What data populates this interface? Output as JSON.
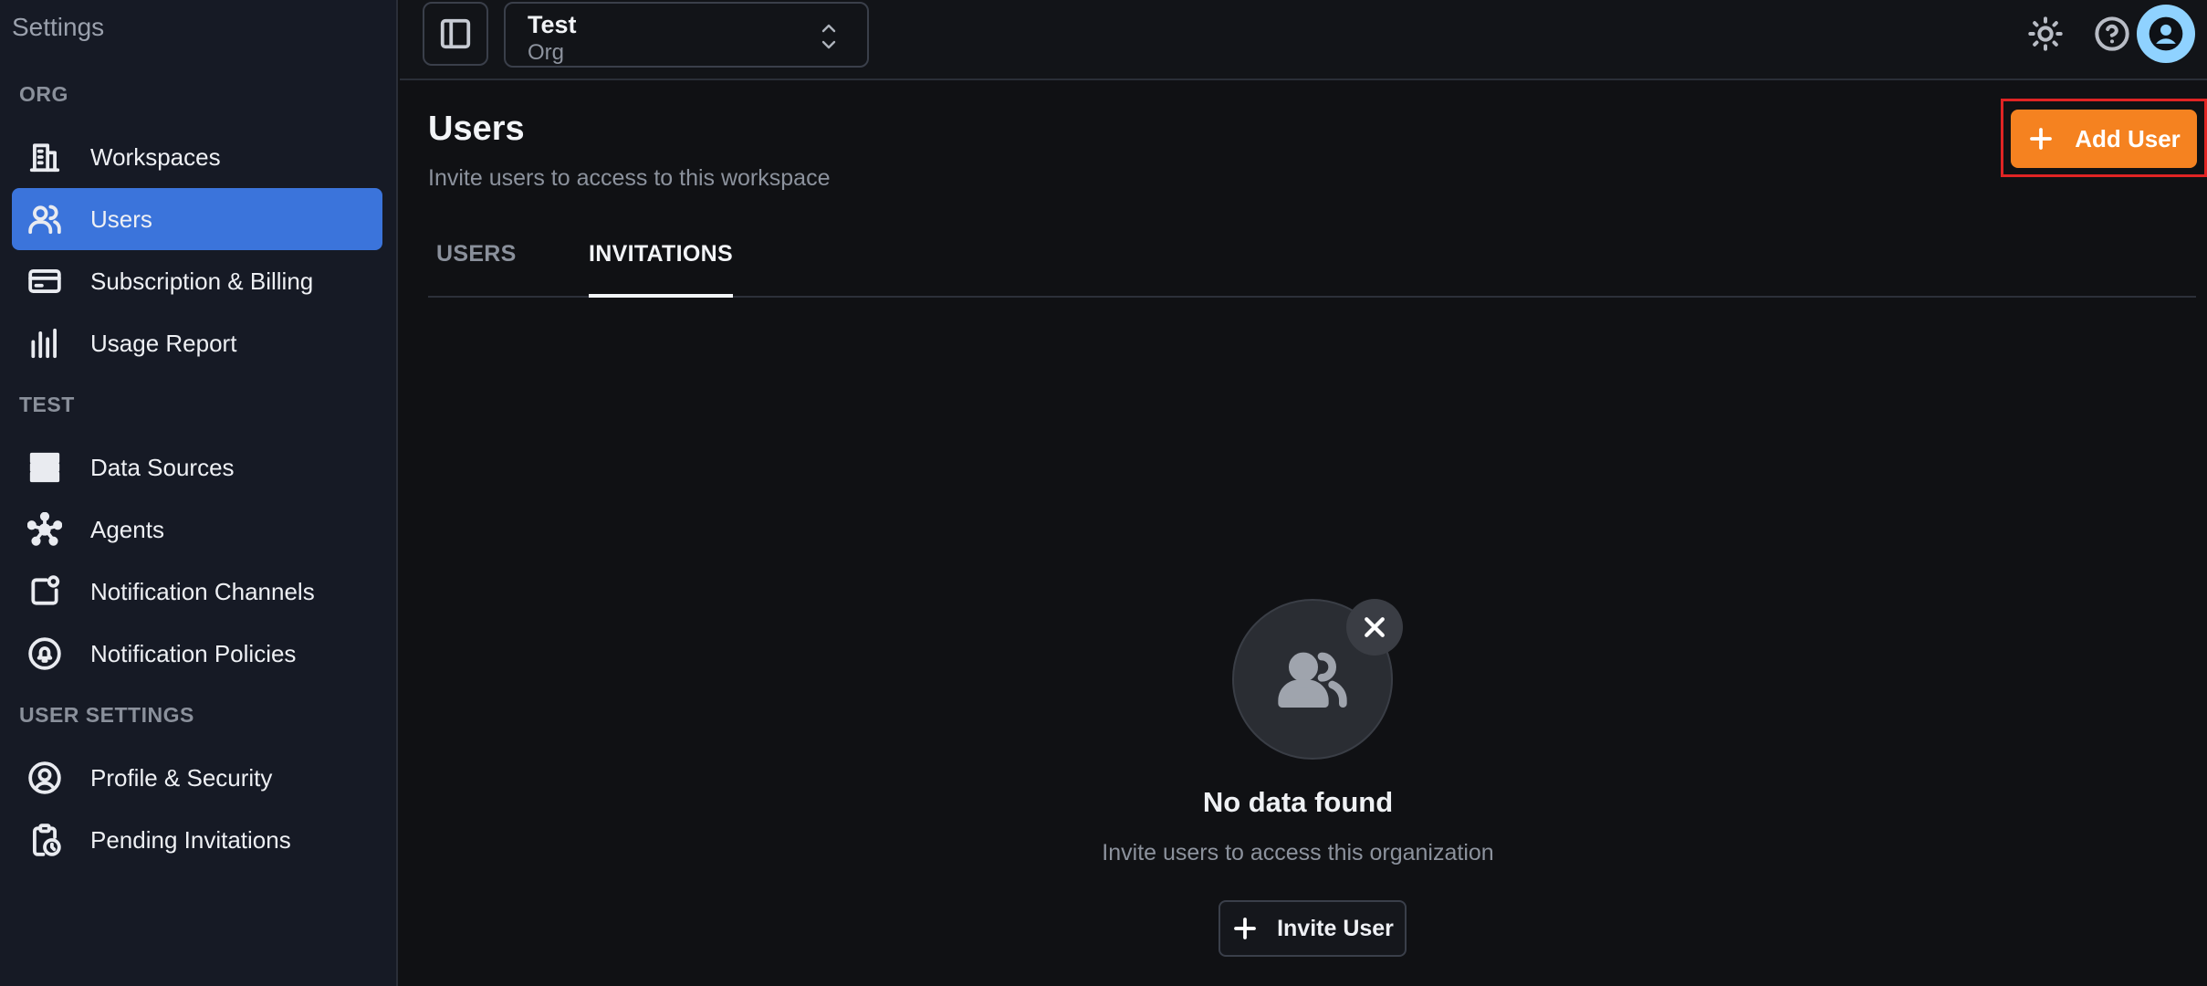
{
  "sidebar": {
    "title": "Settings",
    "sections": {
      "org": "ORG",
      "test": "TEST",
      "user_settings": "USER SETTINGS"
    },
    "items": [
      {
        "label": "Workspaces",
        "icon": "building-icon"
      },
      {
        "label": "Users",
        "icon": "users-icon",
        "active": true
      },
      {
        "label": "Subscription & Billing",
        "icon": "credit-card-icon"
      },
      {
        "label": "Usage Report",
        "icon": "bar-chart-icon"
      },
      {
        "label": "Data Sources",
        "icon": "database-icon"
      },
      {
        "label": "Agents",
        "icon": "network-icon"
      },
      {
        "label": "Notification Channels",
        "icon": "notification-square-icon"
      },
      {
        "label": "Notification Policies",
        "icon": "bell-circle-icon"
      },
      {
        "label": "Profile & Security",
        "icon": "user-circle-icon"
      },
      {
        "label": "Pending Invitations",
        "icon": "clipboard-clock-icon"
      }
    ],
    "active_color": "#3b74db"
  },
  "topbar": {
    "org_name": "Test",
    "org_type": "Org",
    "icons": [
      "sidebar-toggle-icon",
      "sun-icon",
      "help-icon",
      "user-avatar-icon"
    ]
  },
  "main": {
    "title": "Users",
    "subtitle": "Invite users to access to this workspace",
    "add_user_label": "Add User",
    "accent_color": "#f58220",
    "tabs": [
      {
        "label": "USERS",
        "active": false
      },
      {
        "label": "INVITATIONS",
        "active": true
      }
    ],
    "empty_state": {
      "title": "No data found",
      "subtitle": "Invite users to access this organization",
      "button_label": "Invite User"
    }
  }
}
